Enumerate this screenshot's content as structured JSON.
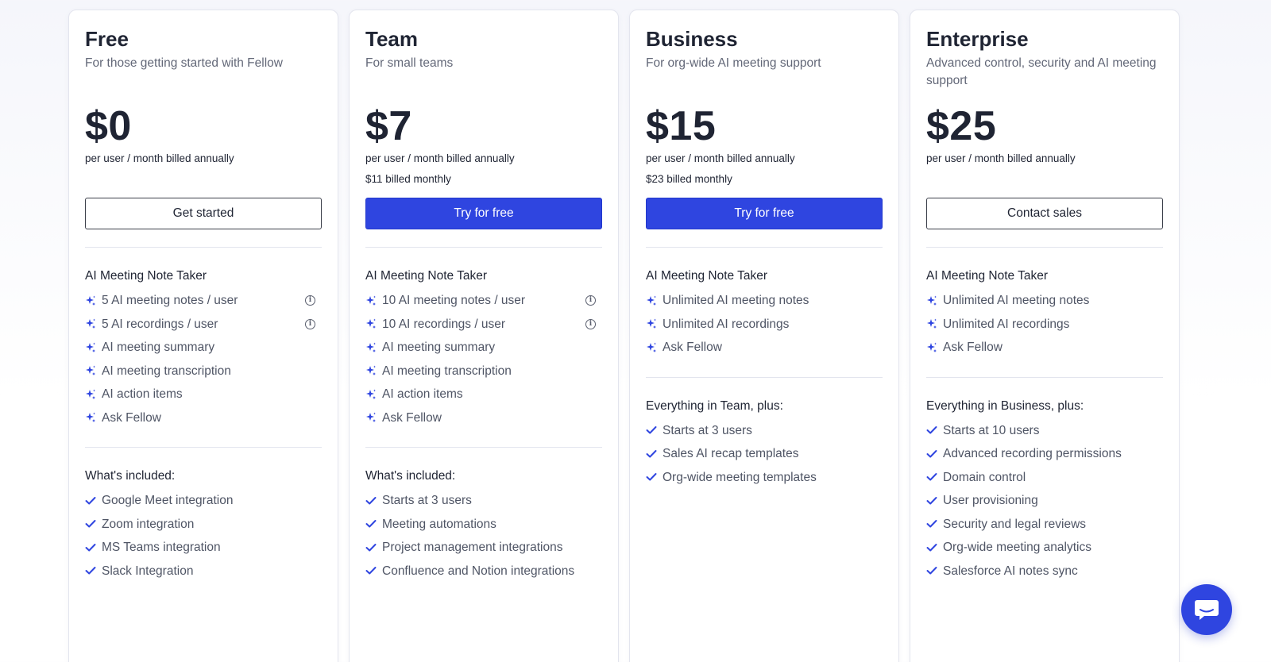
{
  "plans": [
    {
      "name": "Free",
      "description": "For those getting started with Fellow",
      "price": "$0",
      "billing": "per user / month billed annually",
      "billing_monthly": "",
      "button": {
        "label": "Get started",
        "style": "outline"
      },
      "ai_title": "AI Meeting Note Taker",
      "ai_features": [
        {
          "text": "5 AI meeting notes / user",
          "info": true
        },
        {
          "text": "5 AI recordings / user",
          "info": true
        },
        {
          "text": "AI meeting summary",
          "info": false
        },
        {
          "text": "AI meeting transcription",
          "info": false
        },
        {
          "text": "AI action items",
          "info": false
        },
        {
          "text": "Ask Fellow",
          "info": false
        }
      ],
      "included_title": "What's included:",
      "included": [
        "Google Meet integration",
        "Zoom integration",
        "MS Teams integration",
        "Slack Integration"
      ]
    },
    {
      "name": "Team",
      "description": "For small teams",
      "price": "$7",
      "billing": "per user / month billed annually",
      "billing_monthly": "$11 billed monthly",
      "button": {
        "label": "Try for free",
        "style": "primary"
      },
      "ai_title": "AI Meeting Note Taker",
      "ai_features": [
        {
          "text": "10 AI meeting notes / user",
          "info": true
        },
        {
          "text": "10 AI recordings / user",
          "info": true
        },
        {
          "text": "AI meeting summary",
          "info": false
        },
        {
          "text": "AI meeting transcription",
          "info": false
        },
        {
          "text": "AI action items",
          "info": false
        },
        {
          "text": "Ask Fellow",
          "info": false
        }
      ],
      "included_title": "What's included:",
      "included": [
        "Starts at 3 users",
        "Meeting automations",
        "Project management integrations",
        "Confluence and Notion integrations"
      ]
    },
    {
      "name": "Business",
      "description": "For org-wide AI meeting support",
      "price": "$15",
      "billing": "per user / month billed annually",
      "billing_monthly": "$23 billed monthly",
      "button": {
        "label": "Try for free",
        "style": "primary"
      },
      "ai_title": "AI Meeting Note Taker",
      "ai_features": [
        {
          "text": "Unlimited AI meeting notes",
          "info": false
        },
        {
          "text": "Unlimited AI  recordings",
          "info": false
        },
        {
          "text": "Ask Fellow",
          "info": false
        }
      ],
      "included_title": "Everything in Team, plus:",
      "included": [
        "Starts at 3 users",
        "Sales AI recap templates",
        "Org-wide meeting templates"
      ]
    },
    {
      "name": "Enterprise",
      "description": "Advanced control, security and AI meeting support",
      "price": "$25",
      "billing": "per user / month billed annually",
      "billing_monthly": "",
      "button": {
        "label": "Contact sales",
        "style": "outline"
      },
      "ai_title": "AI Meeting Note Taker",
      "ai_features": [
        {
          "text": "Unlimited AI meeting notes",
          "info": false
        },
        {
          "text": "Unlimited AI recordings",
          "info": false
        },
        {
          "text": "Ask Fellow",
          "info": false
        }
      ],
      "included_title": "Everything in Business, plus:",
      "included": [
        "Starts at 10 users",
        "Advanced recording permissions",
        "Domain control",
        "User provisioning",
        "Security and legal reviews",
        "Org-wide meeting analytics",
        "Salesforce AI notes sync"
      ]
    }
  ],
  "colors": {
    "accent": "#2f45e0",
    "text": "#1f2433",
    "muted": "#4f5565",
    "border": "#e3e5ee"
  },
  "icons": {
    "ai_feature": "sparkle-icon",
    "included": "check-icon",
    "info": "info-icon",
    "chat": "chat-bubble-icon"
  }
}
